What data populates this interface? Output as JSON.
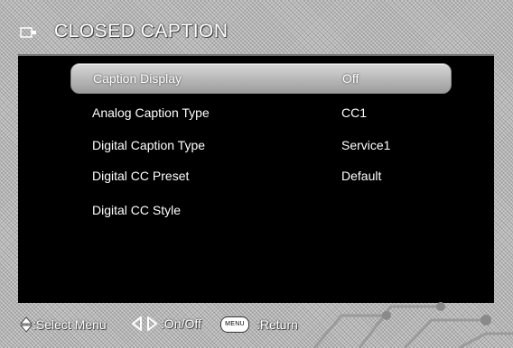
{
  "title": "CLOSED CAPTION",
  "menu": {
    "items": [
      {
        "label": "Caption Display",
        "value": "Off",
        "selected": true
      },
      {
        "label": "Analog Caption Type",
        "value": "CC1",
        "selected": false
      },
      {
        "label": "Digital Caption Type",
        "value": "Service1",
        "selected": false
      },
      {
        "label": "Digital CC Preset",
        "value": "Default",
        "selected": false
      },
      {
        "label": "Digital CC Style",
        "value": "",
        "selected": false
      }
    ]
  },
  "footer": {
    "select_label": ":Select Menu",
    "onoff_label": ":On/Off",
    "menu_key_label": "MENU",
    "return_label": ":Return",
    "icons": [
      "up-down-arrow-icon",
      "left-right-arrow-icon",
      "menu-key-icon"
    ]
  }
}
